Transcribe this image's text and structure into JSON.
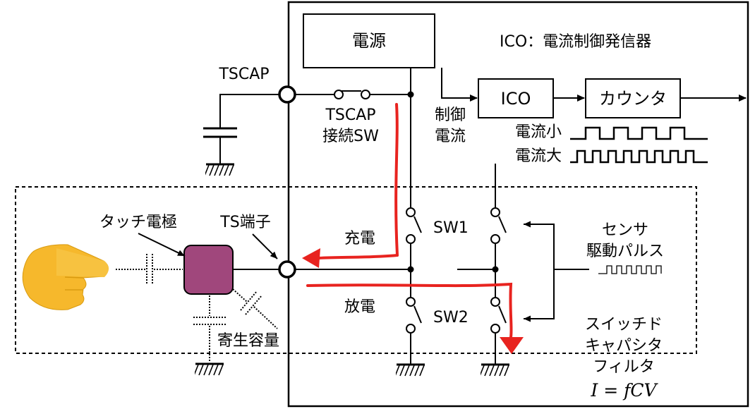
{
  "blocks": {
    "power": "電源",
    "ico": "ICO",
    "counter": "カウンタ",
    "ico_legend": "ICO：電流制御発信器"
  },
  "labels": {
    "tscap": "TSCAP",
    "tscap_sw_line1": "TSCAP",
    "tscap_sw_line2": "接続SW",
    "control_line1": "制御",
    "control_line2": "電流",
    "current_small": "電流小",
    "current_large": "電流大",
    "touch_electrode": "タッチ電極",
    "ts_terminal": "TS端子",
    "charge": "充電",
    "discharge": "放電",
    "sw1": "SW1",
    "sw2": "SW2",
    "sensor_line1": "センサ",
    "sensor_line2": "駆動パルス",
    "parasitic": "寄生容量",
    "filter_line1": "スイッチド",
    "filter_line2": "キャパシタ",
    "filter_line3": "フィルタ",
    "formula": "I = fCV"
  },
  "colors": {
    "wire": "#000000",
    "current_path": "#e8231f",
    "electrode_fill": "#a0477c",
    "finger": "#f6b82c"
  },
  "icons": [
    "pointing-finger-icon",
    "ground-icon",
    "capacitor-icon",
    "switch-icon"
  ]
}
